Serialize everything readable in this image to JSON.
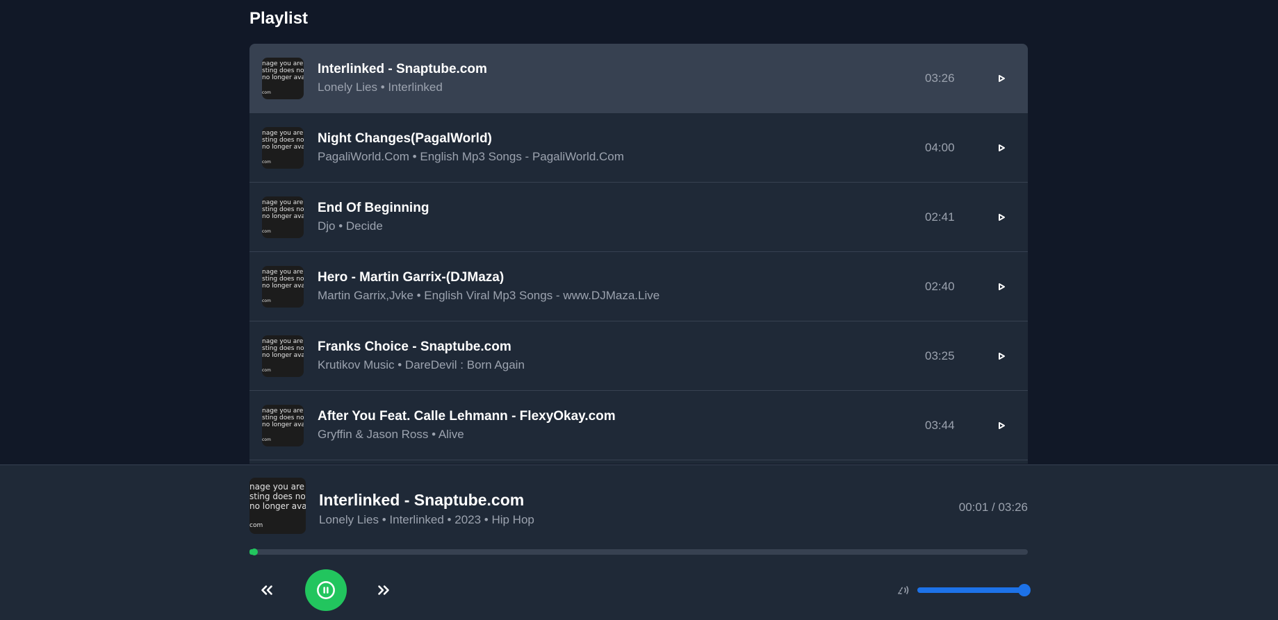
{
  "playlist": {
    "title": "Playlist",
    "thumbnail_text": [
      "nage you are",
      "sting does not",
      "no longer avail",
      "com"
    ],
    "tracks": [
      {
        "title": "Interlinked - Snaptube.com",
        "subtitle": "Lonely Lies • Interlinked",
        "duration": "03:26",
        "active": true
      },
      {
        "title": "Night Changes(PagalWorld)",
        "subtitle": "PagaliWorld.Com • English Mp3 Songs - PagaliWorld.Com",
        "duration": "04:00",
        "active": false
      },
      {
        "title": "End Of Beginning",
        "subtitle": "Djo • Decide",
        "duration": "02:41",
        "active": false
      },
      {
        "title": "Hero - Martin Garrix-(DJMaza)",
        "subtitle": "Martin Garrix,Jvke • English Viral Mp3 Songs - www.DJMaza.Live",
        "duration": "02:40",
        "active": false
      },
      {
        "title": "Franks Choice - Snaptube.com",
        "subtitle": "Krutikov Music • DareDevil : Born Again",
        "duration": "03:25",
        "active": false
      },
      {
        "title": "After You Feat. Calle Lehmann - FlexyOkay.com",
        "subtitle": "Gryffin & Jason Ross • Alive",
        "duration": "03:44",
        "active": false
      }
    ]
  },
  "player": {
    "title": "Interlinked - Snaptube.com",
    "subtitle": "Lonely Lies • Interlinked • 2023 • Hip Hop",
    "time": "00:01 / 03:26",
    "progress_percent": 0.5,
    "volume_percent": 100,
    "colors": {
      "progress": "#22c55e",
      "volume": "#1d72e8",
      "pause_button": "#22c55e"
    },
    "icons": {
      "prev": "chevrons-left-icon",
      "pause": "pause-circle-icon",
      "next": "chevrons-right-icon",
      "volume": "volume-icon",
      "track_play": "play-icon"
    }
  }
}
